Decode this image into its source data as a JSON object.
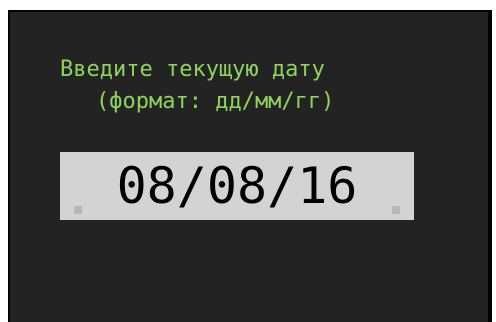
{
  "prompt": {
    "line1": "Введите текущую дату",
    "line2": "(формат: дд/мм/гг)"
  },
  "date_input": {
    "value": "08/08/16"
  },
  "colors": {
    "screen_background": "#232323",
    "prompt_text": "#8ed35c",
    "input_background": "#d3d3d3",
    "input_text": "#000000"
  }
}
